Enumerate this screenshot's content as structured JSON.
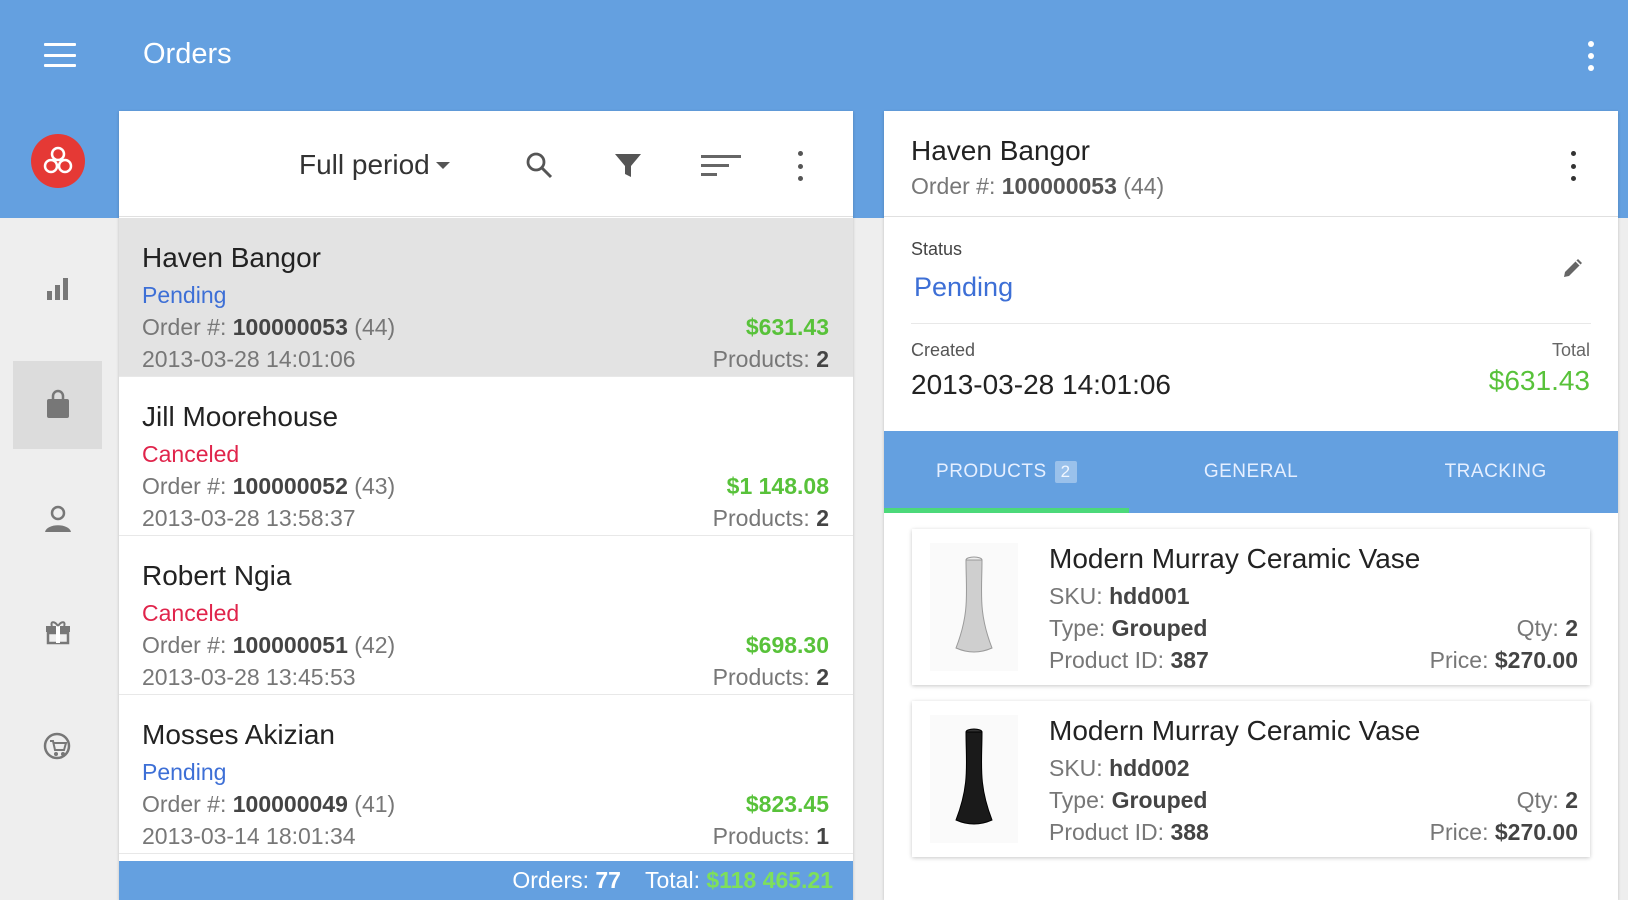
{
  "app_bar": {
    "title": "Orders"
  },
  "sidebar": {
    "items": [
      {
        "icon": "bar-chart-icon"
      },
      {
        "icon": "shopping-bag-icon",
        "active": true
      },
      {
        "icon": "customer-icon"
      },
      {
        "icon": "products-box-icon"
      },
      {
        "icon": "cart-icon"
      }
    ]
  },
  "list": {
    "period_label": "Full period",
    "orders": [
      {
        "customer": "Haven Bangor",
        "status": "Pending",
        "order_prefix": "Order #:",
        "order_number": "100000053",
        "order_id": "(44)",
        "date": "2013-03-28 14:01:06",
        "amount": "$631.43",
        "products_label": "Products:",
        "products_count": "2",
        "selected": true
      },
      {
        "customer": "Jill Moorehouse",
        "status": "Canceled",
        "order_prefix": "Order #:",
        "order_number": "100000052",
        "order_id": "(43)",
        "date": "2013-03-28 13:58:37",
        "amount": "$1 148.08",
        "products_label": "Products:",
        "products_count": "2"
      },
      {
        "customer": "Robert Ngia",
        "status": "Canceled",
        "order_prefix": "Order #:",
        "order_number": "100000051",
        "order_id": "(42)",
        "date": "2013-03-28 13:45:53",
        "amount": "$698.30",
        "products_label": "Products:",
        "products_count": "2"
      },
      {
        "customer": "Mosses Akizian",
        "status": "Pending",
        "order_prefix": "Order #:",
        "order_number": "100000049",
        "order_id": "(41)",
        "date": "2013-03-14 18:01:34",
        "amount": "$823.45",
        "products_label": "Products:",
        "products_count": "1"
      }
    ],
    "footer": {
      "orders_label": "Orders:",
      "orders_count": "77",
      "total_label": "Total:",
      "total_value": "$118 465.21"
    }
  },
  "detail": {
    "customer": "Haven Bangor",
    "order_prefix": "Order #:",
    "order_number": "100000053",
    "order_id": "(44)",
    "status_label": "Status",
    "status_value": "Pending",
    "created_label": "Created",
    "created_value": "2013-03-28 14:01:06",
    "total_label": "Total",
    "total_value": "$631.43",
    "tabs": [
      {
        "label": "PRODUCTS",
        "badge": "2",
        "active": true
      },
      {
        "label": "GENERAL"
      },
      {
        "label": "TRACKING"
      }
    ],
    "products": [
      {
        "name": "Modern Murray Ceramic Vase",
        "sku_label": "SKU:",
        "sku": "hdd001",
        "type_label": "Type:",
        "type": "Grouped",
        "pid_label": "Product ID:",
        "pid": "387",
        "qty_label": "Qty:",
        "qty": "2",
        "price_label": "Price:",
        "price": "$270.00",
        "image": "white-vase"
      },
      {
        "name": "Modern Murray Ceramic Vase",
        "sku_label": "SKU:",
        "sku": "hdd002",
        "type_label": "Type:",
        "type": "Grouped",
        "pid_label": "Product ID:",
        "pid": "388",
        "qty_label": "Qty:",
        "qty": "2",
        "price_label": "Price:",
        "price": "$270.00",
        "image": "black-vase"
      }
    ]
  },
  "colors": {
    "primary": "#64a0e0",
    "pending": "#3d6fd6",
    "canceled": "#e0244b",
    "money": "#58c23a",
    "tab_indicator": "#4cd97a",
    "logo": "#e53935"
  }
}
